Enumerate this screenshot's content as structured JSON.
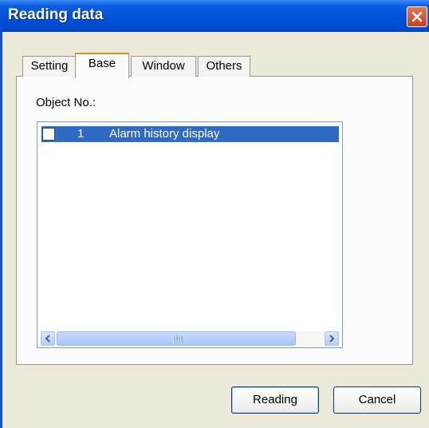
{
  "window": {
    "title": "Reading data"
  },
  "tabs": [
    {
      "label": "Setting",
      "active": false
    },
    {
      "label": "Base",
      "active": true
    },
    {
      "label": "Window",
      "active": false
    },
    {
      "label": "Others",
      "active": false
    }
  ],
  "panel": {
    "object_label": "Object No.:",
    "items": [
      {
        "checked": false,
        "number": "1",
        "name": "Alarm history display",
        "selected": true
      }
    ]
  },
  "scrollbar": {
    "grip": "III"
  },
  "buttons": {
    "reading": "Reading",
    "cancel": "Cancel"
  },
  "colors": {
    "selection": "#316ac5",
    "titlebar": "#0050d8",
    "close": "#c8401d",
    "dialog_bg": "#ece9d8"
  },
  "icons": {
    "close": "close-icon",
    "scroll_left": "arrow-left-icon",
    "scroll_right": "arrow-right-icon"
  }
}
